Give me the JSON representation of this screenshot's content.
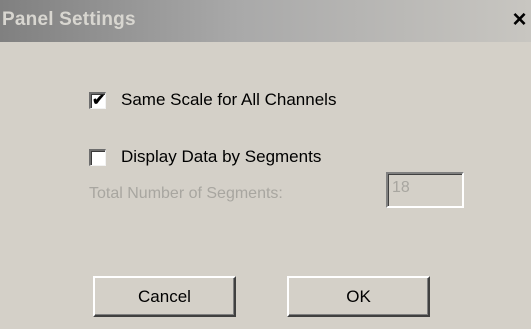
{
  "dialog": {
    "title": "Panel Settings",
    "close_label": "×"
  },
  "options": {
    "same_scale": {
      "label": "Same Scale for All Channels",
      "checked": true,
      "check_glyph": "✔"
    },
    "display_segments": {
      "label": "Display Data by Segments",
      "checked": false
    }
  },
  "segments": {
    "label": "Total Number of Segments:",
    "value": "18",
    "enabled": false
  },
  "buttons": {
    "cancel_label": "Cancel",
    "ok_label": "OK"
  },
  "colors": {
    "dialog_bg": "#d4d0c8",
    "disabled_text": "#a8a6a0",
    "title_text": "#d8d6d0"
  }
}
